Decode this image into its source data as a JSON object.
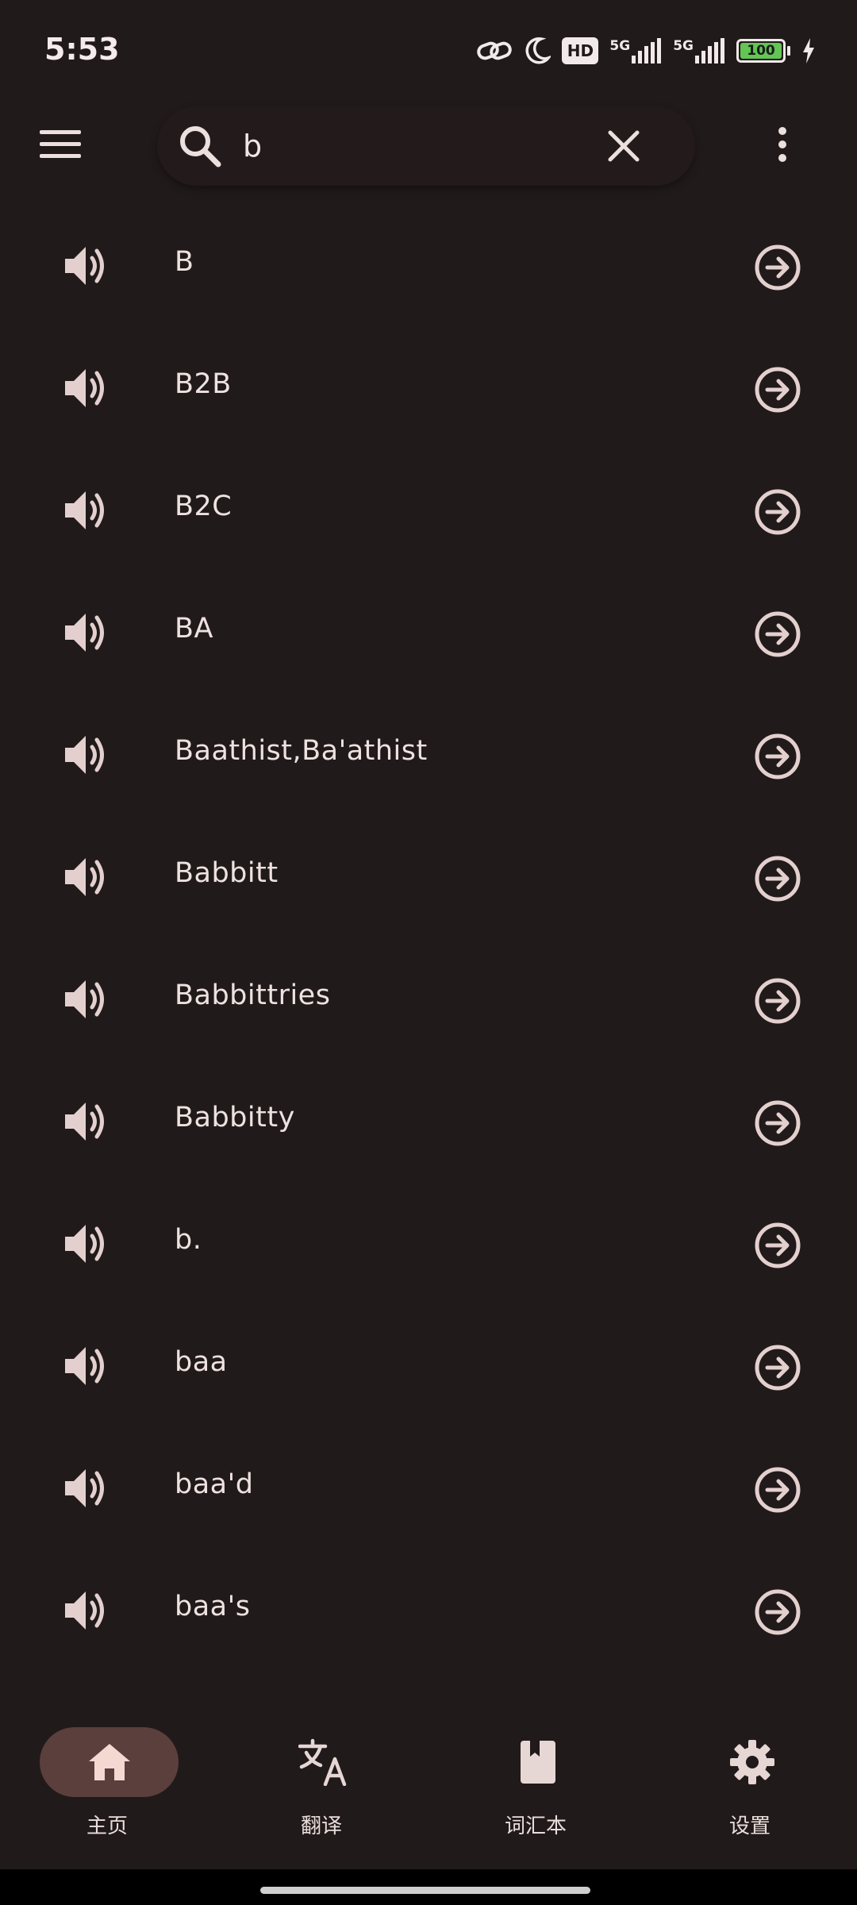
{
  "status_bar": {
    "time": "5:53",
    "icons": [
      "link-icon",
      "moon-icon",
      "hd-voice-icon",
      "signal-5g-icon",
      "signal-5g-icon",
      "battery-icon",
      "charging-icon"
    ],
    "hd_label": "HD",
    "network_1": "5G",
    "network_2": "5G",
    "battery": "100"
  },
  "top_bar": {
    "menu_icon": "menu-icon",
    "search": {
      "value": "b",
      "icon": "search-icon",
      "clear_icon": "close-icon"
    },
    "more_icon": "more-vert-icon"
  },
  "words": [
    {
      "label": "B"
    },
    {
      "label": "B2B"
    },
    {
      "label": "B2C"
    },
    {
      "label": "BA"
    },
    {
      "label": "Baathist,Ba'athist"
    },
    {
      "label": "Babbitt"
    },
    {
      "label": "Babbittries"
    },
    {
      "label": "Babbitty"
    },
    {
      "label": "b."
    },
    {
      "label": "baa"
    },
    {
      "label": "baa'd"
    },
    {
      "label": "baa's"
    }
  ],
  "bottom_nav": {
    "items": [
      {
        "label": "主页",
        "icon": "home-icon",
        "active": true
      },
      {
        "label": "翻译",
        "icon": "translate-icon",
        "active": false
      },
      {
        "label": "词汇本",
        "icon": "bookmark-book-icon",
        "active": false
      },
      {
        "label": "设置",
        "icon": "settings-icon",
        "active": false
      }
    ]
  },
  "colors": {
    "background": "#211a1a",
    "text": "#ecdfdd",
    "icon": "#e3d0ce",
    "active_pill": "#5a3f3c",
    "battery_green": "#62c554"
  }
}
